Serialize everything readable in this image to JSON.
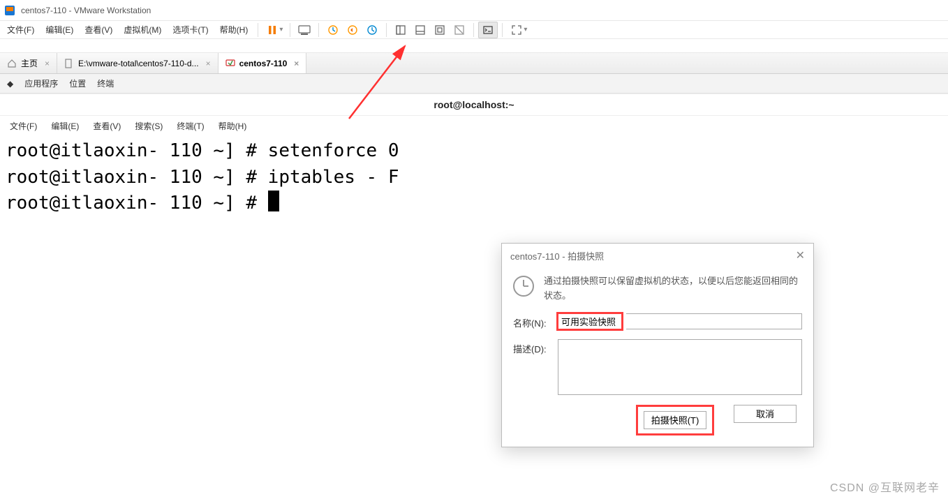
{
  "titlebar": {
    "text": "centos7-110 - VMware Workstation"
  },
  "menubar": {
    "items": [
      "文件(F)",
      "编辑(E)",
      "查看(V)",
      "虚拟机(M)",
      "选项卡(T)",
      "帮助(H)"
    ]
  },
  "tabs": {
    "home": "主页",
    "path": "E:\\vmware-total\\centos7-110-d...",
    "active": "centos7-110"
  },
  "gnomebar": {
    "apps": "应用程序",
    "places": "位置",
    "terminal": "终端"
  },
  "terminal_title": "root@localhost:~",
  "terminal_menu": [
    "文件(F)",
    "编辑(E)",
    "查看(V)",
    "搜索(S)",
    "终端(T)",
    "帮助(H)"
  ],
  "terminal_lines": {
    "l1": "root@itlaoxin- 110 ~] # setenforce 0",
    "l2": "root@itlaoxin- 110 ~] # iptables - F",
    "l3": "root@itlaoxin- 110 ~] # "
  },
  "dialog": {
    "title": "centos7-110 - 拍摄快照",
    "info": "通过拍摄快照可以保留虚拟机的状态，以便以后您能返回相同的状态。",
    "name_label": "名称(N):",
    "name_value": "可用实验快照",
    "desc_label": "描述(D):",
    "desc_value": "",
    "btn_take": "拍摄快照(T)",
    "btn_cancel": "取消"
  },
  "watermark": "CSDN @互联网老辛"
}
